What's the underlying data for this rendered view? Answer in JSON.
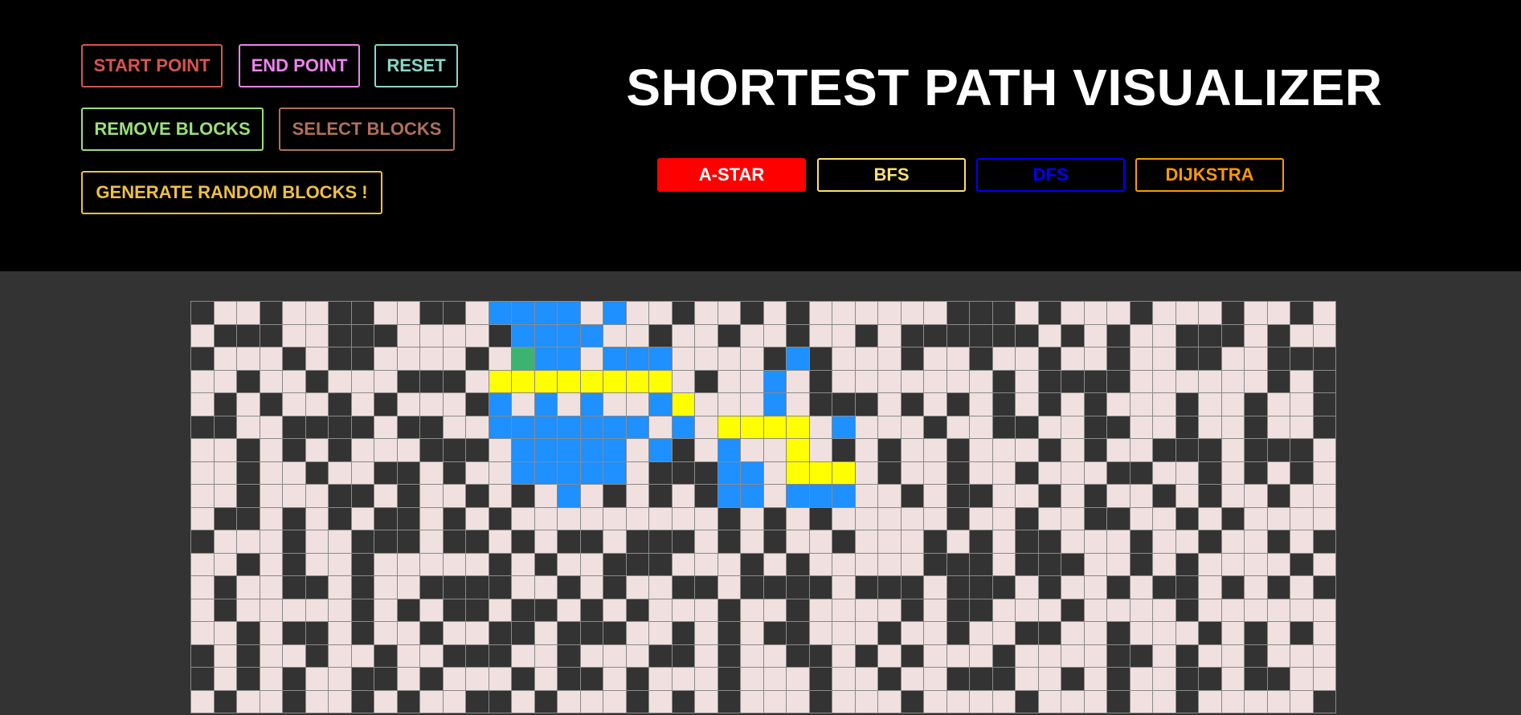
{
  "header": {
    "title": "SHORTEST PATH VISUALIZER"
  },
  "controls": {
    "start_point": "START POINT",
    "end_point": "END POINT",
    "reset": "RESET",
    "remove_blocks": "REMOVE BLOCKS",
    "select_blocks": "SELECT BLOCKS",
    "generate_random": "GENERATE RANDOM BLOCKS !"
  },
  "algorithms": {
    "astar": "A-STAR",
    "bfs": "BFS",
    "dfs": "DFS",
    "dijkstra": "DIJKSTRA",
    "selected": "A-STAR"
  },
  "colors": {
    "start_point": "#d9534f",
    "end_point": "#ee82ee",
    "reset": "#88d8c8",
    "remove_blocks": "#9be07a",
    "select_blocks": "#b0705a",
    "generate_random": "#f0c040",
    "astar_bg": "#ff0000",
    "bfs": "#ffe070",
    "dfs": "#0000ff",
    "dijkstra": "#ff9900",
    "cell_empty": "#f0e0e0",
    "cell_wall": "#333333",
    "cell_visited": "#1e90ff",
    "cell_path": "#ffff00",
    "cell_start": "#3cb371"
  },
  "grid": {
    "cols": 50,
    "visible_rows": 18,
    "rows": [
      "#..#..##..##.VVVV.V..#..#.#......###.#...#...#..#.",
      ".###..###....#VVVV..#..#..#..#.######.#.#..###.#..",
      "#...#.##....#.SVV.VVV....#V#...#..#..#..#..##..###",
      "..#..#...###.PPPPPPPP.#..V.#.......#.####......#.#",
      ".#.#..#.#...#V.V.V..VP...V.###.#.#.#.#.#...#..#..#",
      "##..####.##..VVVVVVV.V.PPPP.V...#..##..##..#..#..#",
      "..#.#.#...###.VVVVV.V#.V..P.#.#..#...#.#..###.###",
      "..#..#..##.#..VVVVV.###VV.PPP.#..#..#...##..#.#.#.",
      "..#...##.#..#.#.V.#.#.#VV.VVV..#.##..#.#..#.#..#..",
      ".##.#.#.##.#.#.........#.#.#.....#..#..##..#.#...",
      "#...#..###.##.#.##.###.#.#..#...#.#.##...#..#..#.#",
      "..#.#..#.....#.#..###...#.#.....###.###..#.#....#.",
      ".#..##.#..####..#.#..##.####.###.###.#..#.##.#.#.#",
      ".#.....#.#.##.##.#.#...#..#....#.##...#....#.....",
      "..#.##.#..#..##.###..#.#.##...#..#..##..#...#.#.#.",
      "#.#..#..#..###..#...##.#..##.#.#...#....##.#..#...",
      "#.#.#..##.#...#.##.#...#...#..#..###..#.#..##.##.",
      ".#..#..#.#..##.#...#.#.#...#...#....#...#..#.....#"
    ]
  }
}
